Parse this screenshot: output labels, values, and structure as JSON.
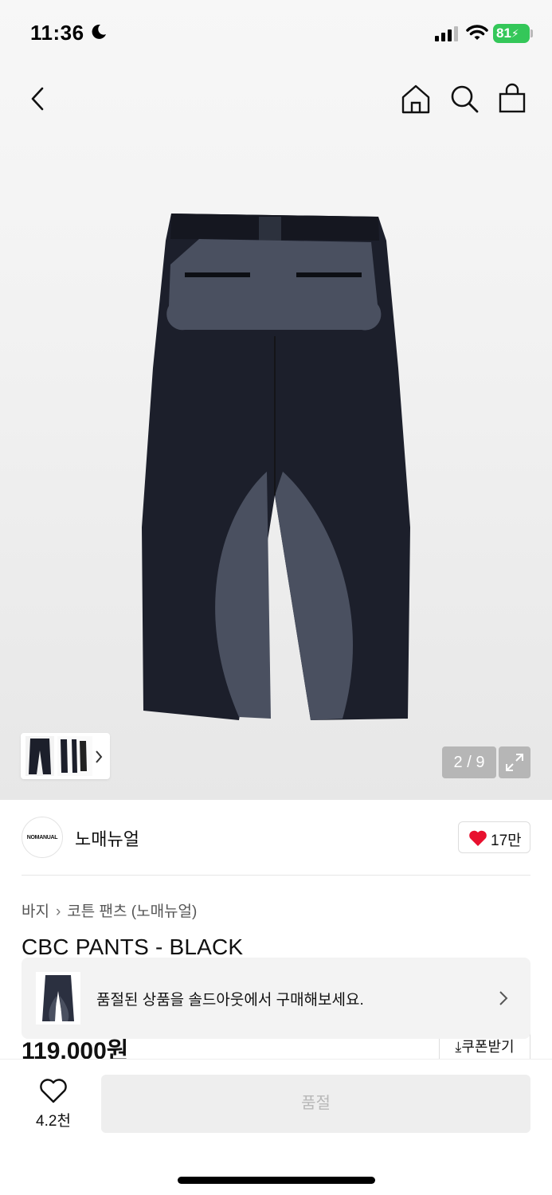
{
  "status_bar": {
    "time": "11:36",
    "battery": "81"
  },
  "gallery": {
    "counter": "2 / 9"
  },
  "brand": {
    "logo_text": "NOMANUAL",
    "name": "노매뉴얼",
    "likes": "17만"
  },
  "breadcrumb": {
    "category": "바지",
    "subcategory": "코튼 팬츠 (노매뉴얼)"
  },
  "product": {
    "title": "CBC PANTS - BLACK",
    "price": "119,000원"
  },
  "coupon_label": "쿠폰받기",
  "soldout_banner": {
    "text": "품절된 상품을 솔드아웃에서 구매해보세요."
  },
  "bottom_bar": {
    "wish_count": "4.2천",
    "action_label": "품절"
  },
  "colors": {
    "battery": "#34c759",
    "heart": "#e8102e",
    "pants_dark": "#1c1f2b",
    "pants_gray": "#4a5060"
  },
  "icons": [
    "back-icon",
    "home-icon",
    "search-icon",
    "bag-icon",
    "expand-icon",
    "heart-icon",
    "chevron-right-icon"
  ]
}
